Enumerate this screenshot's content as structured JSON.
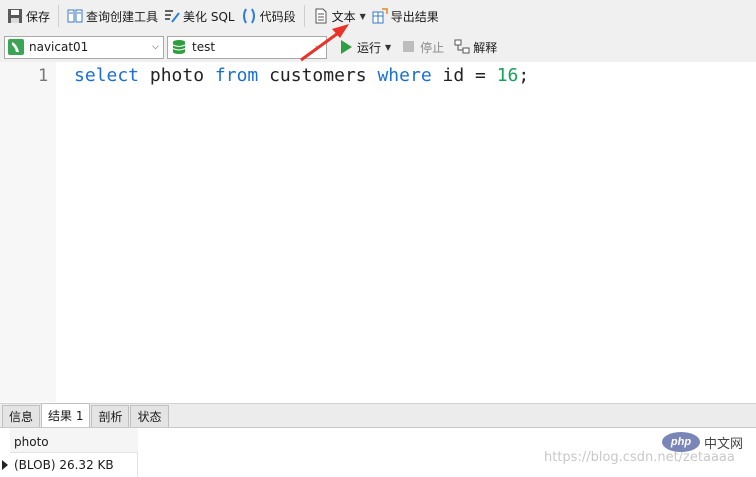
{
  "toolbar": {
    "save_label": "保存",
    "query_builder_label": "查询创建工具",
    "beautify_label": "美化 SQL",
    "snippet_label": "代码段",
    "text_label": "文本",
    "export_label": "导出结果"
  },
  "selectors": {
    "connection": "navicat01",
    "database": "test"
  },
  "run_controls": {
    "run_label": "运行",
    "stop_label": "停止",
    "explain_label": "解释"
  },
  "editor": {
    "line_number": "1",
    "tokens": [
      {
        "text": "select",
        "kind": "keyword"
      },
      {
        "text": " photo ",
        "kind": "plain"
      },
      {
        "text": "from",
        "kind": "keyword"
      },
      {
        "text": " customers ",
        "kind": "plain"
      },
      {
        "text": "where",
        "kind": "keyword"
      },
      {
        "text": " id = ",
        "kind": "plain"
      },
      {
        "text": "16",
        "kind": "number"
      },
      {
        "text": ";",
        "kind": "plain"
      }
    ]
  },
  "result_tabs": [
    {
      "label": "信息",
      "active": false
    },
    {
      "label": "结果 1",
      "active": true
    },
    {
      "label": "剖析",
      "active": false
    },
    {
      "label": "状态",
      "active": false
    }
  ],
  "result_grid": {
    "columns": [
      "photo"
    ],
    "rows": [
      [
        "(BLOB) 26.32 KB"
      ]
    ]
  },
  "watermark": {
    "url": "https://blog.csdn.net/zetaaaa",
    "logo_text": "php",
    "site_name": "中文网"
  },
  "colors": {
    "keyword": "#1a6fd6",
    "number": "#13a35a",
    "annotation_arrow": "#e8332a"
  }
}
